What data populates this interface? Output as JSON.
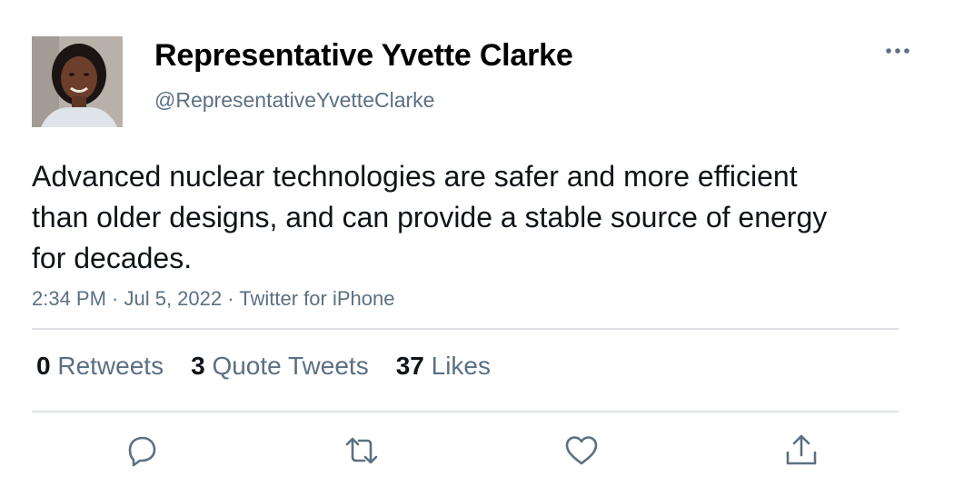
{
  "author": {
    "display_name": "Representative Yvette Clarke",
    "handle": "@RepresentativeYvetteClarke",
    "avatar_icon": "profile-photo"
  },
  "tweet": {
    "text": "Advanced nuclear technologies are safer and more efficient than older designs, and can provide a stable source of energy for decades.",
    "meta": "2:34 PM · Jul 5, 2022 · Twitter for iPhone"
  },
  "stats": {
    "retweets": {
      "count": "0",
      "label": "Retweets"
    },
    "quotes": {
      "count": "3",
      "label": "Quote Tweets"
    },
    "likes": {
      "count": "37",
      "label": "Likes"
    }
  },
  "actions": [
    "reply-icon",
    "retweet-icon",
    "like-icon",
    "share-icon"
  ],
  "colors": {
    "text": "#0f1419",
    "secondary": "#5b7083",
    "divider": "#dfe3e6",
    "icon": "#5b7083"
  }
}
